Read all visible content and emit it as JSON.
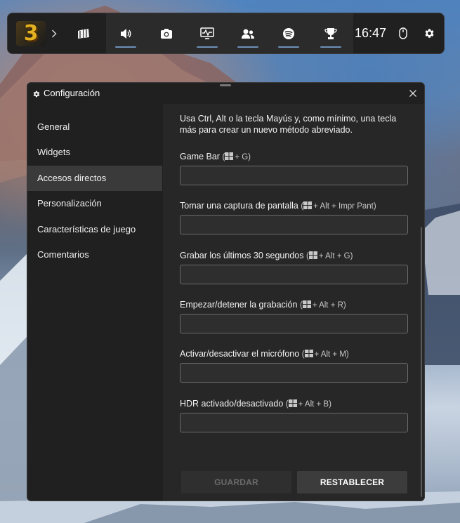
{
  "gamebar": {
    "time": "16:47",
    "logo_text": "3",
    "widgets": [
      {
        "name": "widget-menu-icon"
      },
      {
        "name": "audio-icon"
      },
      {
        "name": "capture-icon"
      },
      {
        "name": "performance-icon"
      },
      {
        "name": "xbox-social-icon"
      },
      {
        "name": "spotify-icon"
      },
      {
        "name": "achievements-icon"
      }
    ],
    "accent": "#6d90b8"
  },
  "window": {
    "title": "Configuración",
    "sidebar": {
      "items": [
        {
          "label": "General"
        },
        {
          "label": "Widgets"
        },
        {
          "label": "Accesos directos"
        },
        {
          "label": "Personalización"
        },
        {
          "label": "Características de juego"
        },
        {
          "label": "Comentarios"
        }
      ],
      "active_index": 2
    },
    "intro": "Usa Ctrl, Alt o la tecla Mayús y, como mínimo, una tecla más para crear un nuevo método abreviado.",
    "shortcuts": [
      {
        "label": "Game Bar",
        "combo": "+ G",
        "value": ""
      },
      {
        "label": "Tomar una captura de pantalla",
        "combo": "+ Alt + Impr Pant",
        "value": ""
      },
      {
        "label": "Grabar los últimos 30 segundos",
        "combo": "+ Alt + G",
        "value": ""
      },
      {
        "label": "Empezar/detener la grabación",
        "combo": "+ Alt + R",
        "value": ""
      },
      {
        "label": "Activar/desactivar el micrófono",
        "combo": "+ Alt + M",
        "value": ""
      },
      {
        "label": "HDR activado/desactivado",
        "combo": "+ Alt + B",
        "value": ""
      }
    ],
    "buttons": {
      "save": "GUARDAR",
      "reset": "RESTABLECER"
    }
  }
}
